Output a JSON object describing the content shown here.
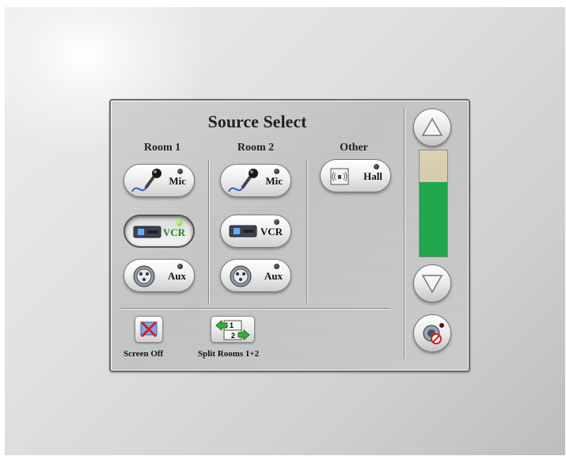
{
  "panel": {
    "title": "Source Select",
    "columns": [
      "Room 1",
      "Room 2",
      "Other"
    ]
  },
  "room1": {
    "sources": [
      {
        "label": "Mic",
        "icon": "microphone-icon",
        "led": "off",
        "selected": false
      },
      {
        "label": "VCR",
        "icon": "vcr-icon",
        "led": "on",
        "selected": true
      },
      {
        "label": "Aux",
        "icon": "xlr-connector-icon",
        "led": "off",
        "selected": false
      }
    ]
  },
  "room2": {
    "sources": [
      {
        "label": "Mic",
        "icon": "microphone-icon",
        "led": "off",
        "selected": false
      },
      {
        "label": "VCR",
        "icon": "vcr-icon",
        "led": "off",
        "selected": false
      },
      {
        "label": "Aux",
        "icon": "xlr-connector-icon",
        "led": "off",
        "selected": false
      }
    ]
  },
  "other": {
    "sources": [
      {
        "label": "Hall",
        "icon": "speaker-wave-icon",
        "led": "off",
        "selected": false
      }
    ]
  },
  "bottom": {
    "screen_off_label": "Screen Off",
    "split_rooms_label": "Split Rooms 1+2",
    "split_icon_numbers": [
      "1",
      "2"
    ]
  },
  "volume": {
    "level_fraction": 0.7,
    "up_icon": "triangle-up-icon",
    "down_icon": "triangle-down-icon",
    "mute_icon": "speaker-mute-icon"
  },
  "colors": {
    "led_on": "#56c21c",
    "selected_text": "#178a17",
    "meter_fill": "#21a74e",
    "meter_empty": "#dcd1b2",
    "cancel_red": "#d42020"
  }
}
